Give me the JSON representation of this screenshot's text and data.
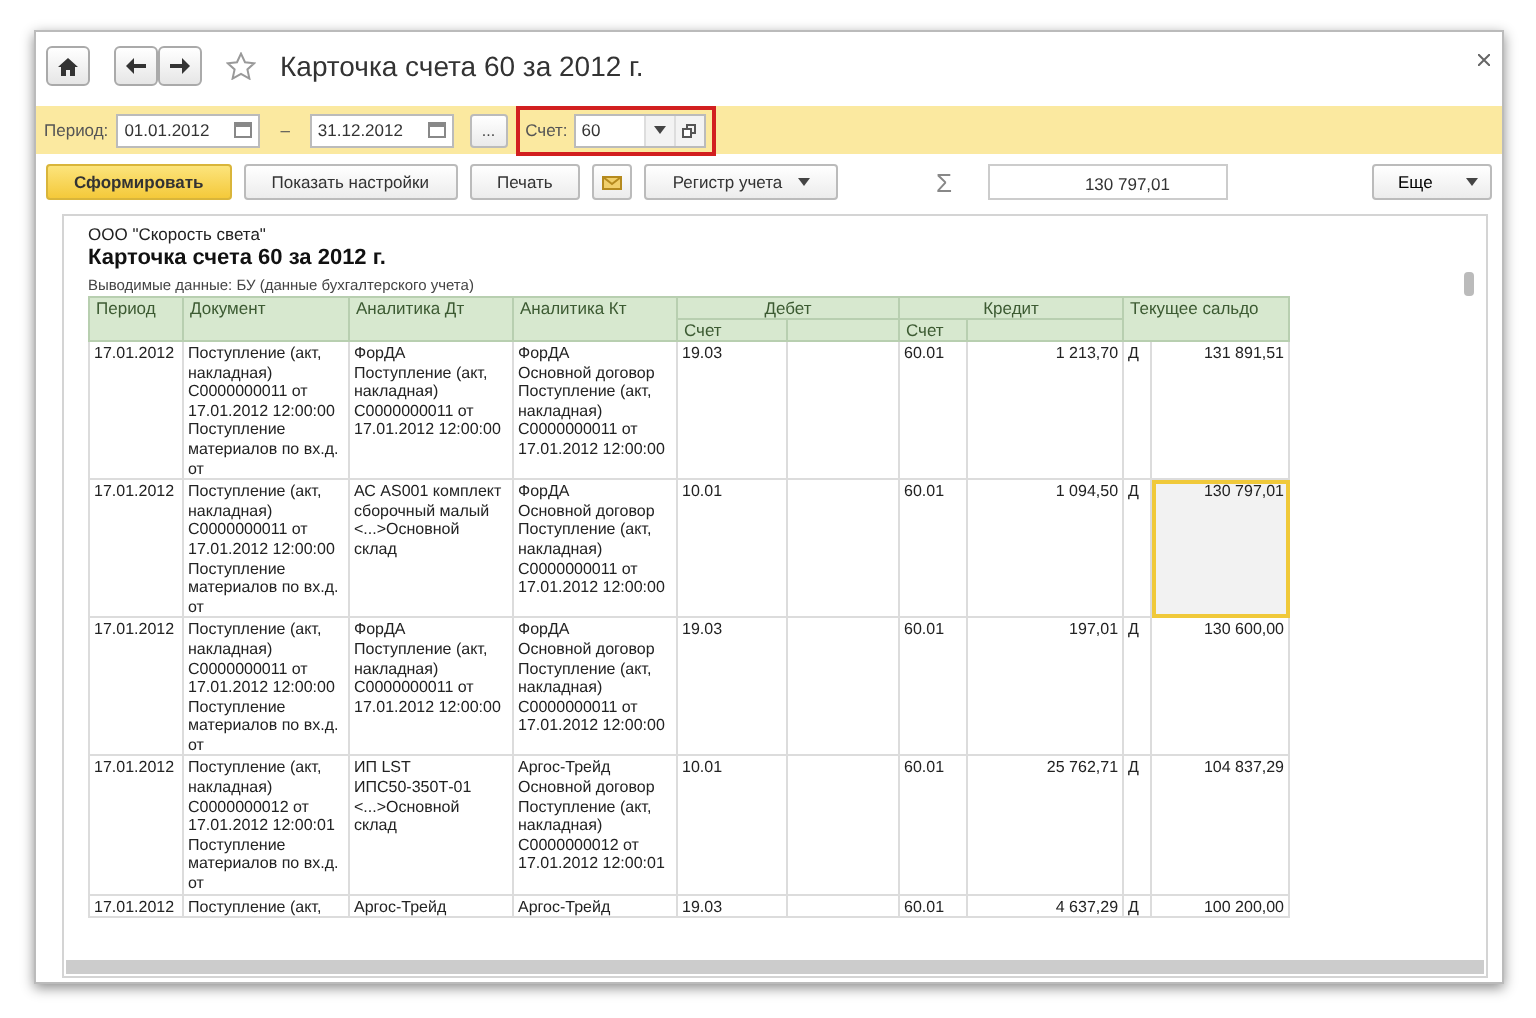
{
  "window": {
    "title": "Карточка счета 60 за 2012 г."
  },
  "filters": {
    "period_label": "Период:",
    "date_from": "01.01.2012",
    "separator": "–",
    "date_to": "31.12.2012",
    "more_button": "...",
    "account_label": "Счет:",
    "account": "60",
    "highlighted": true
  },
  "toolbar": {
    "buttons": [
      {
        "label": "Сформировать",
        "kind": "primary"
      },
      {
        "label": "Показать настройки",
        "kind": "plain"
      },
      {
        "label": "Печать",
        "kind": "plain"
      },
      {
        "kind": "icon"
      },
      {
        "label": "Регистр учета",
        "kind": "dropdown"
      }
    ],
    "sum_symbol": "Σ",
    "sum": "130 797,01",
    "more": "Еще"
  },
  "report": {
    "company": "ООО \"Скорость света\"",
    "title": "Карточка счета 60 за 2012 г.",
    "output": "Выводимые данные:  БУ (данные бухгалтерского учета)",
    "columns": [
      {
        "label": "Период"
      },
      {
        "label": "Документ"
      },
      {
        "label": "Аналитика Дт"
      },
      {
        "label": "Аналитика Кт"
      },
      {
        "label": "Дебет",
        "sub": "Счет"
      },
      {
        "label": "Кредит",
        "sub": "Счет"
      },
      {
        "label": "Текущее сальдо"
      }
    ],
    "rows": [
      {
        "date": "17.01.2012",
        "document": "Поступление (акт,\nнакладная)\nС0000000011 от\n17.01.2012 12:00:00\nПоступление\nматериалов по вх.д.\nот",
        "dt": "ФорДА\nПоступление (акт,\nнакладная)\nС0000000011 от\n17.01.2012 12:00:00",
        "kt": "ФорДА\nОсновной договор\nПоступление (акт,\nнакладная)\nС0000000011 от\n17.01.2012 12:00:00",
        "debit_account": "19.03",
        "credit_account": "60.01",
        "credit_amount": "1 213,70",
        "side": "Д",
        "saldo": "131 891,51",
        "selected": false
      },
      {
        "date": "17.01.2012",
        "document": "Поступление (акт,\nнакладная)\nС0000000011 от\n17.01.2012 12:00:00\nПоступление\nматериалов по вх.д.\nот",
        "dt": "АС AS001 комплект\nсборочный малый\n<...>Основной\nсклад",
        "kt": "ФорДА\nОсновной договор\nПоступление (акт,\nнакладная)\nС0000000011 от\n17.01.2012 12:00:00",
        "debit_account": "10.01",
        "credit_account": "60.01",
        "credit_amount": "1 094,50",
        "side": "Д",
        "saldo": "130 797,01",
        "selected": true
      },
      {
        "date": "17.01.2012",
        "document": "Поступление (акт,\nнакладная)\nС0000000011 от\n17.01.2012 12:00:00\nПоступление\nматериалов по вх.д.\nот",
        "dt": "ФорДА\nПоступление (акт,\nнакладная)\nС0000000011 от\n17.01.2012 12:00:00",
        "kt": "ФорДА\nОсновной договор\nПоступление (акт,\nнакладная)\nС0000000011 от\n17.01.2012 12:00:00",
        "debit_account": "19.03",
        "credit_account": "60.01",
        "credit_amount": "197,01",
        "side": "Д",
        "saldo": "130 600,00",
        "selected": false
      },
      {
        "date": "17.01.2012",
        "document": "Поступление (акт,\nнакладная)\nС0000000012 от\n17.01.2012 12:00:01\nПоступление\nматериалов по вх.д.\nот",
        "dt": "ИП LST\nИПС50-350Т-01\n<...>Основной\nсклад",
        "kt": "Аргос-Трейд\nОсновной договор\nПоступление (акт,\nнакладная)\nС0000000012 от\n17.01.2012 12:00:01",
        "debit_account": "10.01",
        "credit_account": "60.01",
        "credit_amount": "25 762,71",
        "side": "Д",
        "saldo": "104 837,29",
        "selected": false
      },
      {
        "date": "17.01.2012",
        "document": "Поступление (акт,",
        "dt": "Аргос-Трейд",
        "kt": "Аргос-Трейд",
        "debit_account": "19.03",
        "credit_account": "60.01",
        "credit_amount": "4 637,29",
        "side": "Д",
        "saldo": "100 200,00",
        "selected": false
      }
    ]
  }
}
